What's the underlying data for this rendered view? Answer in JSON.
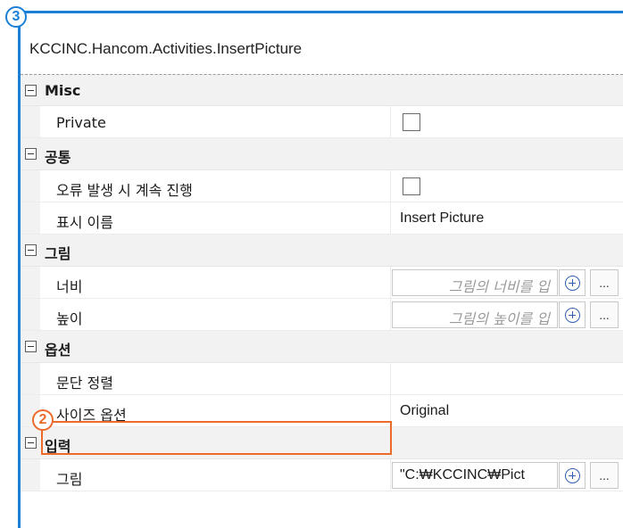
{
  "header": {
    "title": "KCCINC.Hancom.Activities.InsertPicture"
  },
  "categories": [
    {
      "label": "Misc",
      "properties": [
        {
          "name": "Private",
          "type": "checkbox",
          "checked": false
        }
      ]
    },
    {
      "label": "공통",
      "properties": [
        {
          "name": "오류 발생 시 계속 진행",
          "type": "checkbox",
          "checked": false
        },
        {
          "name": "표시 이름",
          "type": "text",
          "value": "Insert Picture"
        }
      ]
    },
    {
      "label": "그림",
      "properties": [
        {
          "name": "너비",
          "type": "input",
          "placeholder": "그림의 너비를 입",
          "value": ""
        },
        {
          "name": "높이",
          "type": "input",
          "placeholder": "그림의 높이를 입",
          "value": ""
        }
      ]
    },
    {
      "label": "옵션",
      "properties": [
        {
          "name": "문단 정렬",
          "type": "text",
          "value": ""
        },
        {
          "name": "사이즈 옵션",
          "type": "text",
          "value": "Original"
        }
      ]
    },
    {
      "label": "입력",
      "properties": [
        {
          "name": "그림",
          "type": "input",
          "placeholder": "",
          "value": "\"C:₩KCCINC₩Pict"
        }
      ]
    }
  ],
  "buttons": {
    "ellipsis_label": "..."
  },
  "annotations": {
    "panel_marker": "3",
    "highlight_marker": "2"
  },
  "colors": {
    "panel_border": "#1a7fd6",
    "highlight_border": "#ec6a2a",
    "category_background": "#f2f2f2"
  }
}
